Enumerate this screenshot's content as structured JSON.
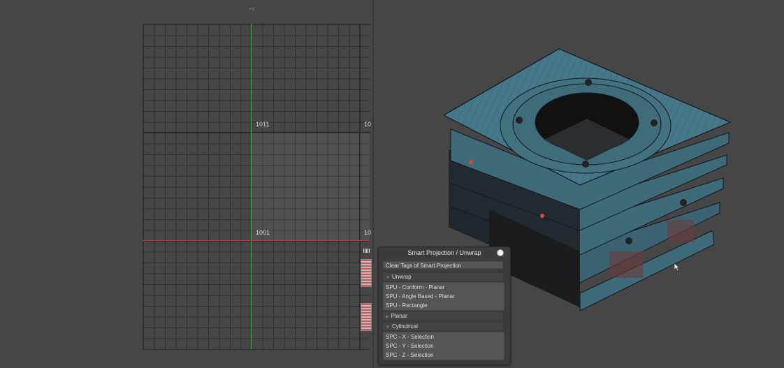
{
  "uv_editor": {
    "top_label": "+V",
    "udim_labels": [
      {
        "text": "1011"
      },
      {
        "text": "10"
      },
      {
        "text": "1001"
      },
      {
        "text": "10"
      }
    ]
  },
  "viewport": {
    "mesh_color": "#3f6a7a",
    "wire_color": "#101820"
  },
  "panel": {
    "title": "Smart Projection / Unwrap",
    "clear_button": "Clear Tags of Smart Projection",
    "sections": {
      "unwrap": {
        "label": "Unwrap",
        "expanded": true,
        "items": [
          "SPU - Conform - Planar",
          "SPU - Angle Based - Planar",
          "SPU - Rectangle"
        ]
      },
      "planar": {
        "label": "Planar",
        "expanded": false
      },
      "cylindrical": {
        "label": "Cylindrical",
        "expanded": true,
        "items": [
          "SPC - X - Selection",
          "SPC - Y - Selection",
          "SPC - Z - Selection"
        ]
      }
    }
  },
  "colors": {
    "u_axis": "#d23030",
    "v_axis": "#3ecf3e",
    "background": "#464646"
  }
}
